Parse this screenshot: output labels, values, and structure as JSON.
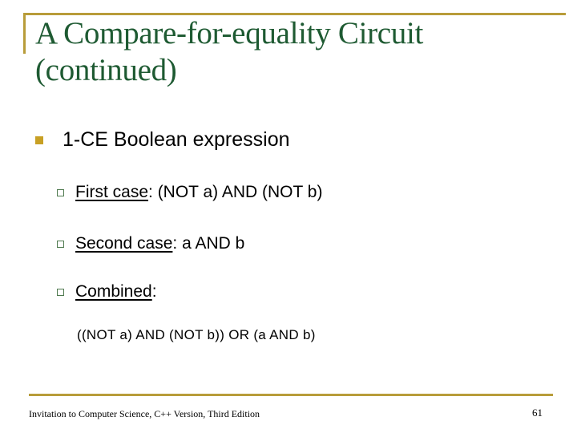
{
  "slide": {
    "title": "A Compare-for-equality Circuit (continued)",
    "bullets": {
      "level1": "1-CE Boolean expression",
      "items": [
        {
          "label": "First case",
          "sep": ":",
          "text": " (NOT a) AND (NOT b)"
        },
        {
          "label": "Second case",
          "sep": ":",
          "text": " a AND b"
        },
        {
          "label": "Combined",
          "sep": ":",
          "text": ""
        }
      ],
      "combined_expression": "((NOT a) AND (NOT b)) OR (a AND b)"
    }
  },
  "footer": {
    "text": "Invitation to Computer Science, C++ Version, Third Edition",
    "page_number": "61"
  },
  "colors": {
    "title": "#1E5A32",
    "accent_rule": "#B89C3A",
    "bullet_level1": "#C8A024",
    "bullet_level2": "#4F7A4F"
  }
}
